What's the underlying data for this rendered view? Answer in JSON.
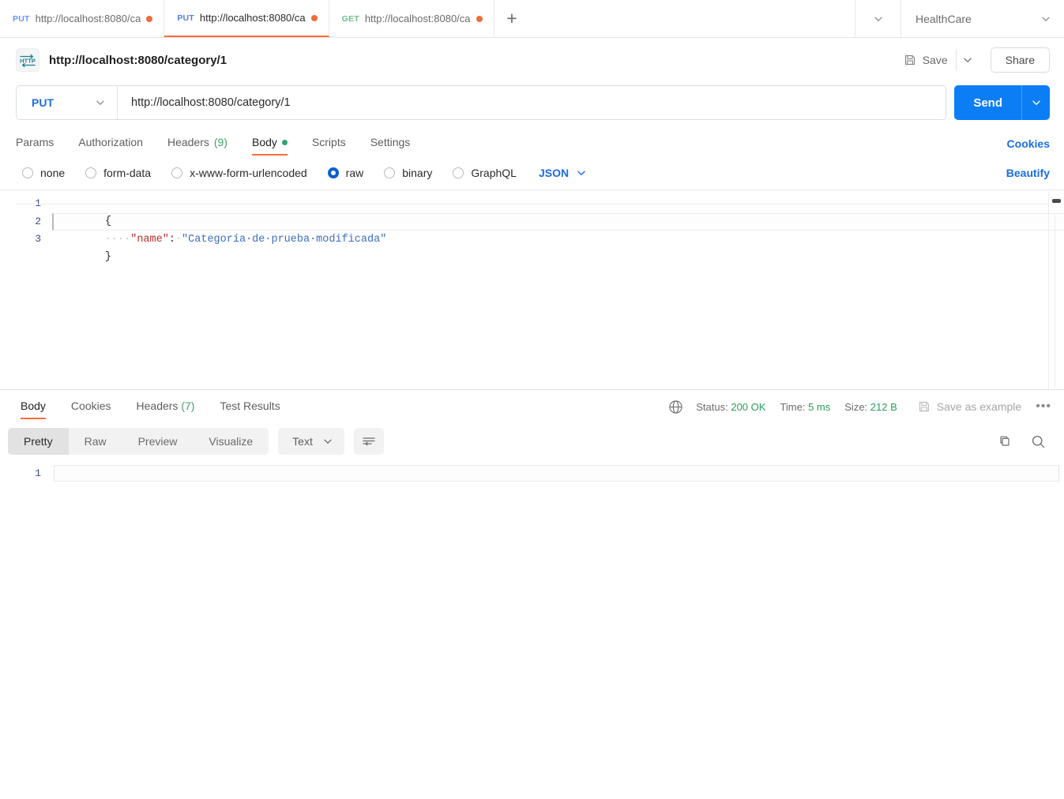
{
  "tabbar": {
    "tabs": [
      {
        "method": "PUT",
        "name": "http://localhost:8080/ca",
        "active": false,
        "unsaved": true
      },
      {
        "method": "PUT",
        "name": "http://localhost:8080/ca",
        "active": true,
        "unsaved": true
      },
      {
        "method": "GET",
        "name": "http://localhost:8080/ca",
        "active": false,
        "unsaved": true
      }
    ],
    "new_tab_label": "+",
    "overflow_caret": "chevron-down-icon",
    "environment": "HealthCare"
  },
  "request_header": {
    "protocol_badge": "HTTP",
    "title": "http://localhost:8080/category/1",
    "save_label": "Save",
    "share_label": "Share"
  },
  "url_bar": {
    "method": "PUT",
    "url": "http://localhost:8080/category/1",
    "send_label": "Send"
  },
  "request_tabs": {
    "items": [
      {
        "label": "Params",
        "active": false
      },
      {
        "label": "Authorization",
        "active": false
      },
      {
        "label": "Headers",
        "count": "(9)",
        "active": false
      },
      {
        "label": "Body",
        "active": true,
        "dot": true
      },
      {
        "label": "Scripts",
        "active": false
      },
      {
        "label": "Settings",
        "active": false
      }
    ],
    "cookies_link": "Cookies"
  },
  "body_types": {
    "options": [
      {
        "label": "none",
        "selected": false
      },
      {
        "label": "form-data",
        "selected": false
      },
      {
        "label": "x-www-form-urlencoded",
        "selected": false
      },
      {
        "label": "raw",
        "selected": true
      },
      {
        "label": "binary",
        "selected": false
      },
      {
        "label": "GraphQL",
        "selected": false
      }
    ],
    "format": "JSON",
    "beautify_link": "Beautify"
  },
  "request_body_editor": {
    "lines": [
      {
        "num": "1",
        "highlighted": false,
        "tokens": [
          {
            "t": "brace",
            "v": "{"
          }
        ]
      },
      {
        "num": "2",
        "highlighted": true,
        "tokens": [
          {
            "t": "ws",
            "v": "····"
          },
          {
            "t": "key",
            "v": "\"name\""
          },
          {
            "t": "punc",
            "v": ":"
          },
          {
            "t": "ws",
            "v": "·"
          },
          {
            "t": "str",
            "v": "\"Categoría·de·prueba·modificada\""
          }
        ]
      },
      {
        "num": "3",
        "highlighted": false,
        "tokens": [
          {
            "t": "brace",
            "v": "}"
          }
        ]
      }
    ],
    "raw_text": "{\n    \"name\": \"Categoría de prueba modificada\"\n}"
  },
  "response": {
    "tabs": [
      {
        "label": "Body",
        "active": true
      },
      {
        "label": "Cookies",
        "active": false
      },
      {
        "label": "Headers",
        "count": "(7)",
        "active": false
      },
      {
        "label": "Test Results",
        "active": false
      }
    ],
    "status_label": "Status:",
    "status_value": "200 OK",
    "time_label": "Time:",
    "time_value": "5 ms",
    "size_label": "Size:",
    "size_value": "212 B",
    "save_as_example": "Save as example",
    "more_dots": "•••",
    "view_modes": [
      {
        "label": "Pretty",
        "active": true
      },
      {
        "label": "Raw",
        "active": false
      },
      {
        "label": "Preview",
        "active": false
      },
      {
        "label": "Visualize",
        "active": false
      }
    ],
    "format": "Text",
    "body_lines": [
      {
        "num": "1",
        "text": ""
      }
    ]
  },
  "colors": {
    "accent_orange": "#ff6c37",
    "send_blue": "#0b7ef5",
    "link_blue": "#1a6ee0",
    "status_green": "#2a9d5c",
    "unsaved_dot": "#f26b3a",
    "method_get": "#6bbf8a",
    "method_put": "#6496f5"
  }
}
